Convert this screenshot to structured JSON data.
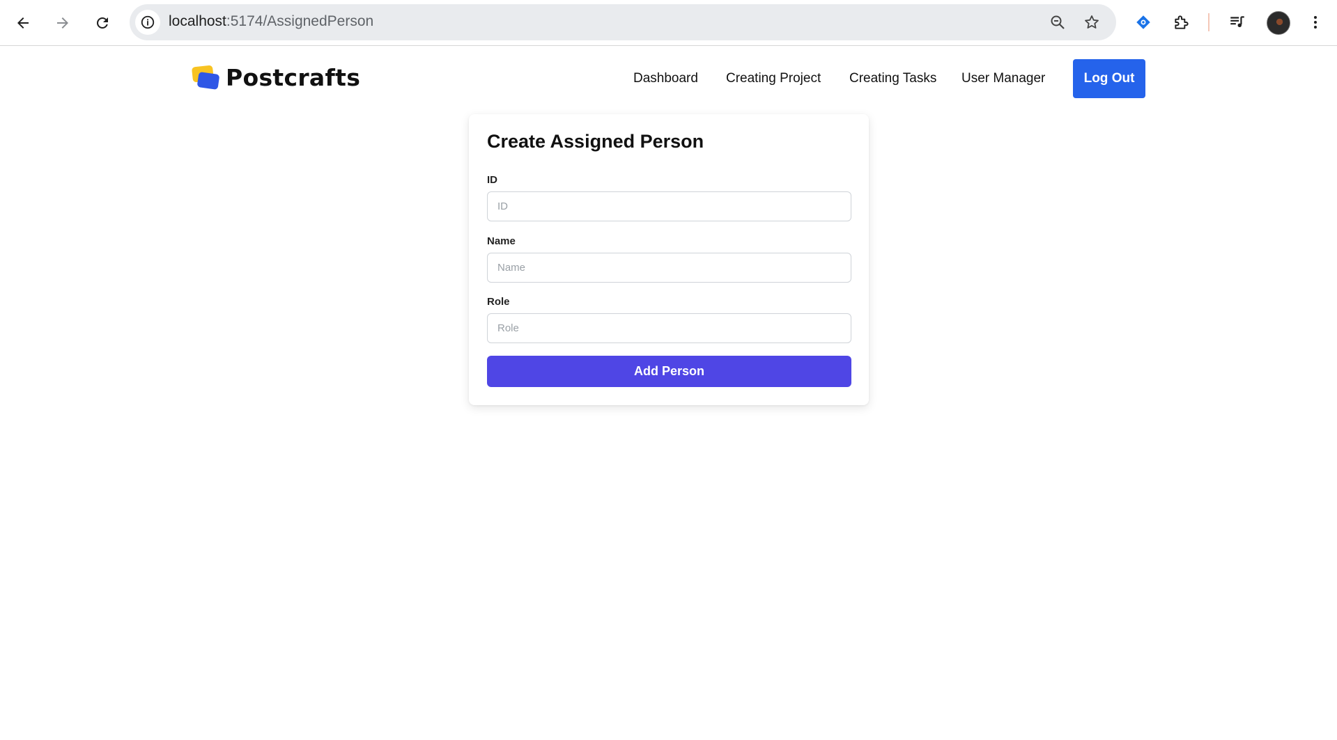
{
  "browser": {
    "url_host": "localhost",
    "url_path": ":5174/AssignedPerson",
    "icons": [
      "back-arrow-icon",
      "forward-arrow-icon",
      "reload-icon",
      "site-info-icon",
      "zoom-icon",
      "bookmark-star-icon",
      "extension-tag-icon",
      "extensions-puzzle-icon",
      "media-queue-icon",
      "profile-avatar",
      "kebab-menu-icon"
    ]
  },
  "header": {
    "brand": "Postcrafts",
    "nav": [
      "Dashboard",
      "Creating Project",
      "Creating Tasks",
      "User Manager"
    ],
    "logout_label": "Log Out"
  },
  "form": {
    "title": "Create Assigned Person",
    "fields": [
      {
        "label": "ID",
        "placeholder": "ID",
        "value": ""
      },
      {
        "label": "Name",
        "placeholder": "Name",
        "value": ""
      },
      {
        "label": "Role",
        "placeholder": "Role",
        "value": ""
      }
    ],
    "submit_label": "Add Person"
  },
  "colors": {
    "logout_button": "#2563eb",
    "submit_button": "#4f46e5",
    "logo_yellow": "#f8c322",
    "logo_blue": "#2f57e6"
  }
}
